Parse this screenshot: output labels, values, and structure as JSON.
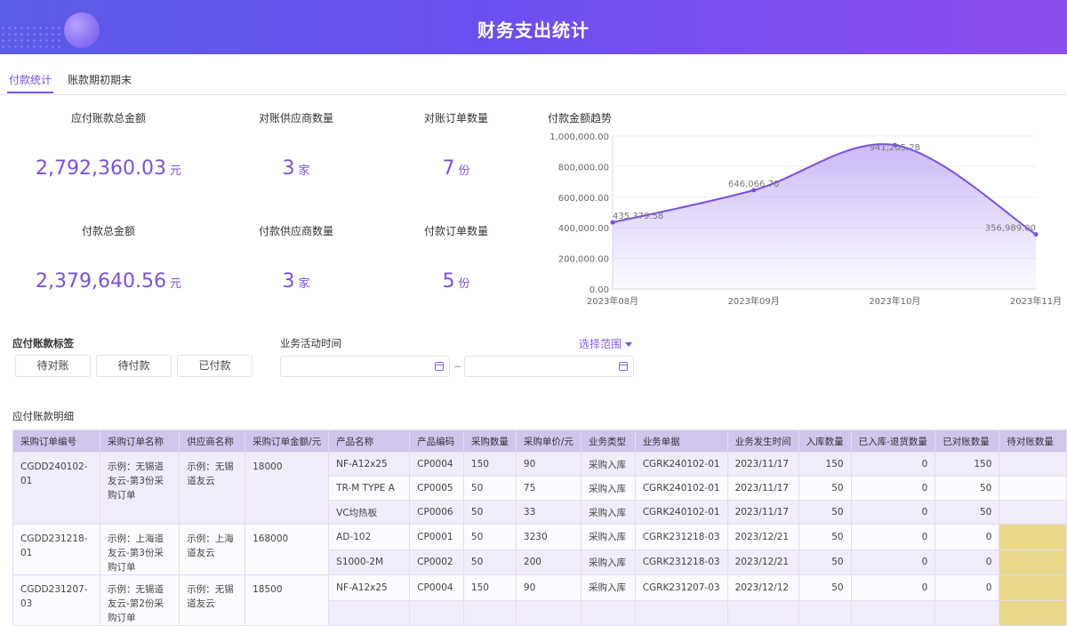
{
  "header": {
    "title": "财务支出统计"
  },
  "tabs": [
    {
      "label": "付款统计",
      "active": true
    },
    {
      "label": "账款期初期末",
      "active": false
    }
  ],
  "stats": [
    {
      "label": "应付账款总金额",
      "value": "2,792,360.03",
      "unit": "元"
    },
    {
      "label": "对账供应商数量",
      "value": "3",
      "unit": "家"
    },
    {
      "label": "对账订单数量",
      "value": "7",
      "unit": "份"
    },
    {
      "label": "付款总金额",
      "value": "2,379,640.56",
      "unit": "元"
    },
    {
      "label": "付款供应商数量",
      "value": "3",
      "unit": "家"
    },
    {
      "label": "付款订单数量",
      "value": "5",
      "unit": "份"
    }
  ],
  "chart_data": {
    "type": "line",
    "title": "付款金额趋势",
    "categories": [
      "2023年08月",
      "2023年09月",
      "2023年10月",
      "2023年11月"
    ],
    "values": [
      435379.58,
      646066.7,
      941205.28,
      356989.0
    ],
    "value_labels": [
      "435,379.58",
      "646,066.70",
      "941,205.28",
      "356,989.00"
    ],
    "ylim": [
      0,
      1000000
    ],
    "yticks": [
      "0.00",
      "200,000.00",
      "400,000.00",
      "600,000.00",
      "800,000.00",
      "1,000,000.00"
    ],
    "color": "#7b4fe8",
    "area": true,
    "smooth": true
  },
  "filters": {
    "tag_label": "应付账款标签",
    "tags": [
      "待对账",
      "待付款",
      "已付款"
    ],
    "time_label": "业务活动时间",
    "range_label": "选择范围",
    "separator": "~"
  },
  "detail": {
    "title": "应付账款明细",
    "columns": [
      "采购订单编号",
      "采购订单名称",
      "供应商名称",
      "采购订单金额/元",
      "产品名称",
      "产品编码",
      "采购数量",
      "采购单价/元",
      "业务类型",
      "业务单据",
      "业务发生时间",
      "入库数量",
      "已入库-退货数量",
      "已对账数量",
      "待对账数量"
    ],
    "orders": [
      {
        "code": "CGDD240102-01",
        "name": "示例：无锡道友云-第3份采购订单",
        "supplier": "示例：无锡道友云",
        "amount": "18000",
        "items": [
          [
            "NF-A12x25",
            "CP0004",
            "150",
            "90",
            "采购入库",
            "CGRK240102-01",
            "2023/11/17",
            "150",
            "0",
            "150",
            ""
          ],
          [
            "TR-M TYPE A",
            "CP0005",
            "50",
            "75",
            "采购入库",
            "CGRK240102-01",
            "2023/11/17",
            "50",
            "0",
            "50",
            ""
          ],
          [
            "VC均热板",
            "CP0006",
            "50",
            "33",
            "采购入库",
            "CGRK240102-01",
            "2023/11/17",
            "50",
            "0",
            "50",
            ""
          ]
        ]
      },
      {
        "code": "CGDD231218-01",
        "name": "示例：上海道友云-第3份采购订单",
        "supplier": "示例：上海道友云",
        "amount": "168000",
        "items": [
          [
            "AD-102",
            "CP0001",
            "50",
            "3230",
            "采购入库",
            "CGRK231218-03",
            "2023/12/21",
            "50",
            "0",
            "0",
            ""
          ],
          [
            "S1000-2M",
            "CP0002",
            "50",
            "200",
            "采购入库",
            "CGRK231218-03",
            "2023/12/21",
            "50",
            "0",
            "0",
            ""
          ]
        ]
      },
      {
        "code": "CGDD231207-03",
        "name": "示例：无锡道友云-第2份采购订单",
        "supplier": "示例：无锡道友云",
        "amount": "18500",
        "items": [
          [
            "NF-A12x25",
            "CP0004",
            "150",
            "90",
            "采购入库",
            "CGRK231207-03",
            "2023/12/12",
            "50",
            "0",
            "0",
            ""
          ],
          [
            "",
            "",
            "",
            "",
            "",
            "",
            "",
            "",
            "",
            "",
            ""
          ]
        ]
      }
    ]
  }
}
